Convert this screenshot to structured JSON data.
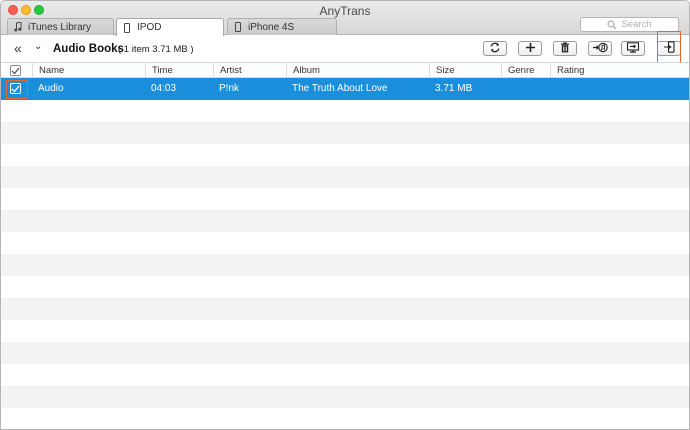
{
  "app": {
    "title": "AnyTrans"
  },
  "tabs": [
    {
      "label": "iTunes Library",
      "icon": "music-note-icon",
      "active": false
    },
    {
      "label": "IPOD",
      "icon": "ipod-icon",
      "active": true
    },
    {
      "label": "iPhone 4S",
      "icon": "iphone-icon",
      "active": false
    }
  ],
  "search": {
    "placeholder": "Search"
  },
  "toolbar": {
    "section_title": "Audio Books",
    "section_count": "( 1 item  3.71 MB )",
    "buttons": [
      {
        "name": "refresh-icon"
      },
      {
        "name": "add-icon"
      },
      {
        "name": "delete-icon"
      },
      {
        "name": "to-itunes-icon"
      },
      {
        "name": "to-computer-icon"
      },
      {
        "name": "to-device-icon"
      }
    ],
    "accent_color": "#e06a2c"
  },
  "table": {
    "columns": [
      "Name",
      "Time",
      "Artist",
      "Album",
      "Size",
      "Genre",
      "Rating"
    ],
    "rows": [
      {
        "name": "Audio",
        "time": "04:03",
        "artist": "P!nk",
        "album": "The Truth About Love",
        "size": "3.71 MB",
        "genre": "",
        "rating": "",
        "selected": true,
        "checked": true
      }
    ],
    "selection_color": "#1c8fdc"
  }
}
